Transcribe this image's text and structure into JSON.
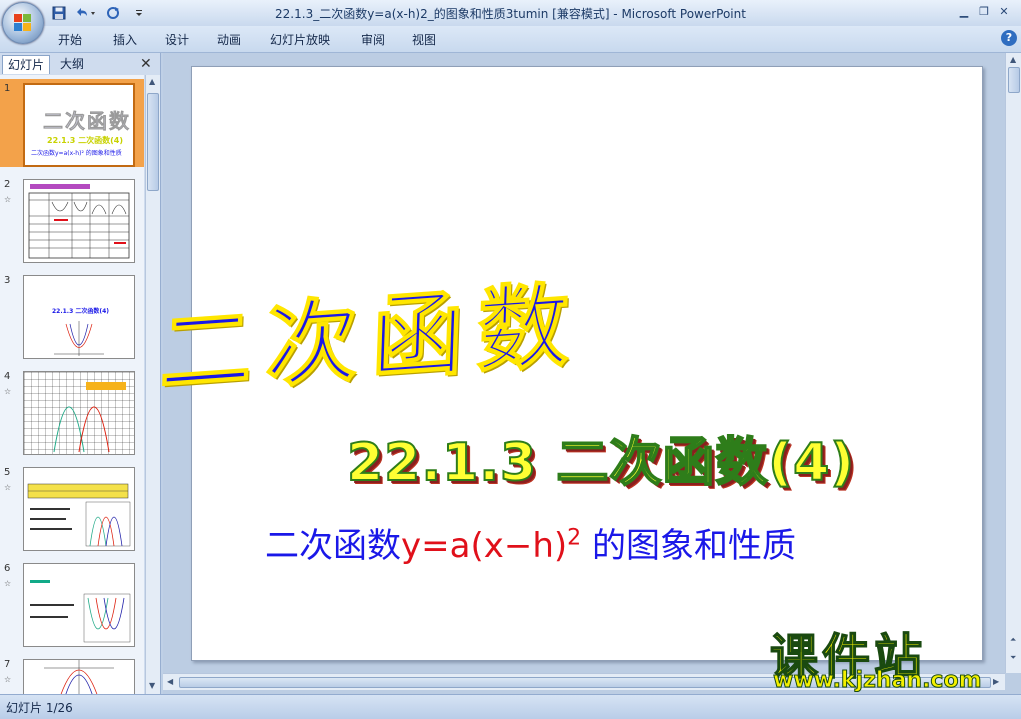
{
  "window": {
    "title": "22.1.3_二次函数y=a(x-h)2_的图象和性质3tumin [兼容模式] - Microsoft PowerPoint"
  },
  "quick_access": {
    "save_icon": "save-icon",
    "undo_icon": "undo-icon",
    "redo_icon": "redo-icon"
  },
  "ribbon": {
    "tabs": [
      "开始",
      "插入",
      "设计",
      "动画",
      "幻灯片放映",
      "审阅",
      "视图"
    ]
  },
  "panel": {
    "tab_slides": "幻灯片",
    "tab_outline": "大纲",
    "close": "✕"
  },
  "thumbnails": [
    {
      "num": "1",
      "selected": true,
      "anim": ""
    },
    {
      "num": "2",
      "selected": false,
      "anim": "☆"
    },
    {
      "num": "3",
      "selected": false,
      "anim": ""
    },
    {
      "num": "4",
      "selected": false,
      "anim": "☆"
    },
    {
      "num": "5",
      "selected": false,
      "anim": "☆"
    },
    {
      "num": "6",
      "selected": false,
      "anim": "☆"
    },
    {
      "num": "7",
      "selected": false,
      "anim": "☆"
    }
  ],
  "thumb1": {
    "title": "二次函数",
    "subtitle": "22.1.3 二次函数(4)",
    "desc": "二次函数y=a(x-h)² 的图象和性质"
  },
  "thumb3": {
    "title": "22.1.3 二次函数(4)"
  },
  "slide": {
    "main_title": "二次函数",
    "sub_title": "22.1.3 二次函数(4)",
    "desc_pre": "二次函数",
    "desc_formula": "y=a(x−h)",
    "desc_exp": "2",
    "desc_post": " 的图象和性质"
  },
  "watermark": {
    "text": "课件站",
    "url": "www.kjzhan.com"
  },
  "status": {
    "slide_info": "幻灯片 1/26"
  },
  "colors": {
    "title_blue": "#1a18e8",
    "formula_red": "#e0101a",
    "subtitle_yellow": "#ffff33",
    "selection_orange": "#f3a24a"
  }
}
